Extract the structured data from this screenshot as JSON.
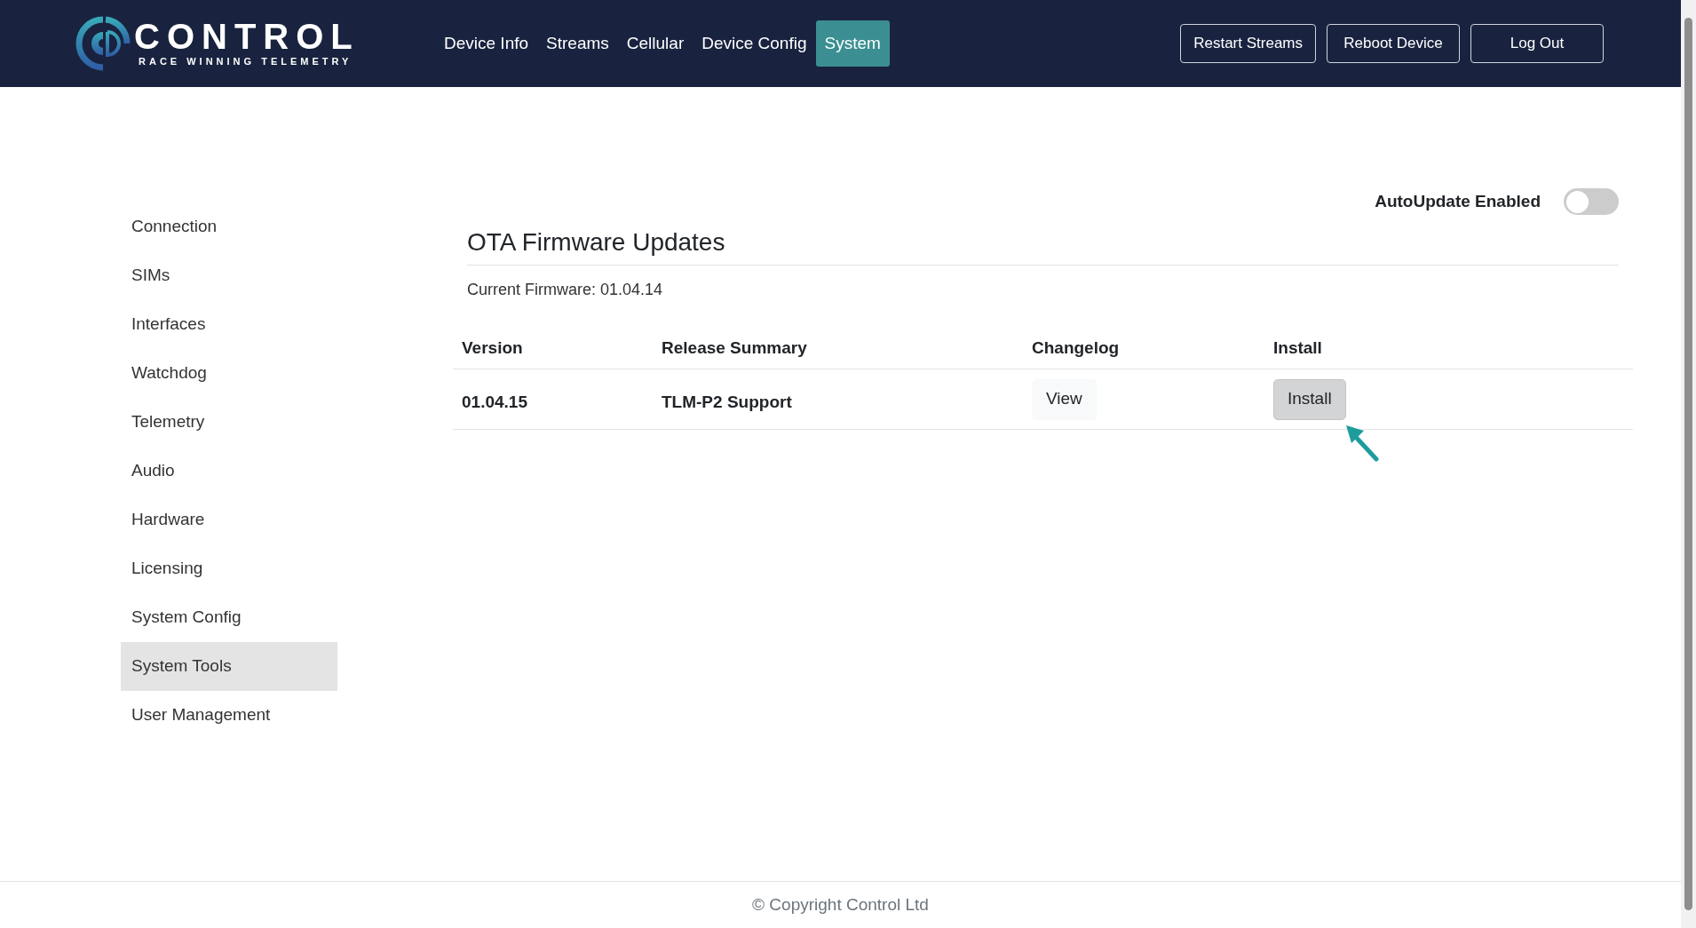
{
  "brand": {
    "name": "CONTROL",
    "tagline": "RACE WINNING TELEMETRY"
  },
  "nav": [
    {
      "label": "Device Info",
      "selected": false
    },
    {
      "label": "Streams",
      "selected": false
    },
    {
      "label": "Cellular",
      "selected": false
    },
    {
      "label": "Device Config",
      "selected": false
    },
    {
      "label": "System",
      "selected": true
    }
  ],
  "header_buttons": [
    "Restart Streams",
    "Reboot Device",
    "Log Out"
  ],
  "sidebar": [
    {
      "label": "Connection",
      "selected": false
    },
    {
      "label": "SIMs",
      "selected": false
    },
    {
      "label": "Interfaces",
      "selected": false
    },
    {
      "label": "Watchdog",
      "selected": false
    },
    {
      "label": "Telemetry",
      "selected": false
    },
    {
      "label": "Audio",
      "selected": false
    },
    {
      "label": "Hardware",
      "selected": false
    },
    {
      "label": "Licensing",
      "selected": false
    },
    {
      "label": "System Config",
      "selected": false
    },
    {
      "label": "System Tools",
      "selected": true
    },
    {
      "label": "User Management",
      "selected": false
    }
  ],
  "autoupdate": {
    "label": "AutoUpdate Enabled",
    "on": false
  },
  "section": {
    "title": "OTA Firmware Updates",
    "current_firmware": "Current Firmware: 01.04.14"
  },
  "table": {
    "columns": [
      "Version",
      "Release Summary",
      "Changelog",
      "Install"
    ],
    "rows": [
      {
        "version": "01.04.15",
        "summary": "TLM-P2 Support",
        "changelog": "View",
        "install": "Install"
      }
    ]
  },
  "footer": "© Copyright Control Ltd"
}
